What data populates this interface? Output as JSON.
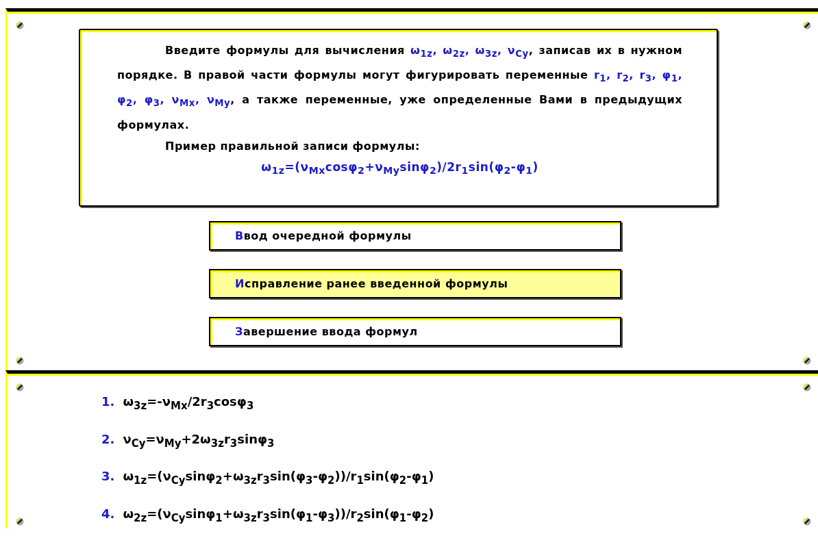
{
  "instructions": {
    "paragraphs": [
      [
        {
          "kind": "text",
          "text": "Введите формулы для вычисления "
        },
        {
          "kind": "math",
          "text": "ω$_{1z}$, ω$_{2z}$, ω$_{3z}$, ν$_{Cy}$"
        },
        {
          "kind": "text",
          "text": ", записав их в нужном порядке. В правой части формулы могут фигурировать переменные "
        },
        {
          "kind": "math",
          "text": "r$_{1}$, r$_{2}$, r$_{3}$, φ$_{1}$, φ$_{2}$, φ$_{3}$, ν$_{Mx}$, ν$_{My}$"
        },
        {
          "kind": "text",
          "text": ", а также переменные, уже определенные Вами в предыдущих формулах."
        }
      ],
      [
        {
          "kind": "text",
          "text": "Пример правильной записи формулы:"
        }
      ]
    ],
    "example": "ω$_{1z}$=(ν$_{Mx}$cosφ$_{2}$+ν$_{My}$sinφ$_{2}$)/2r$_{1}$sin(φ$_{2}$-φ$_{1}$)"
  },
  "menu": [
    {
      "hotkey": "В",
      "label": "вод очередной формулы",
      "selected": false
    },
    {
      "hotkey": "И",
      "label": "справление ранее введенной формулы",
      "selected": true
    },
    {
      "hotkey": "З",
      "label": "авершение ввода формул",
      "selected": false
    }
  ],
  "formulas": [
    {
      "number": "1.",
      "formula": "ω$_{3z}$=-ν$_{Mx}$/2r$_{3}$cosφ$_{3}$"
    },
    {
      "number": "2.",
      "formula": "ν$_{Cy}$=ν$_{My}$+2ω$_{3z}$r$_{3}$sinφ$_{3}$"
    },
    {
      "number": "3.",
      "formula": "ω$_{1z}$=(ν$_{Cy}$sinφ$_{2}$+ω$_{3z}$r$_{3}$sin(φ$_{3}$-φ$_{2}$))/r$_{1}$sin(φ$_{2}$-φ$_{1}$)"
    },
    {
      "number": "4.",
      "formula": "ω$_{2z}$=(ν$_{Cy}$sinφ$_{1}$+ω$_{3z}$r$_{3}$sin(φ$_{1}$-φ$_{3}$))/r$_{2}$sin(φ$_{1}$-φ$_{2}$)"
    }
  ]
}
